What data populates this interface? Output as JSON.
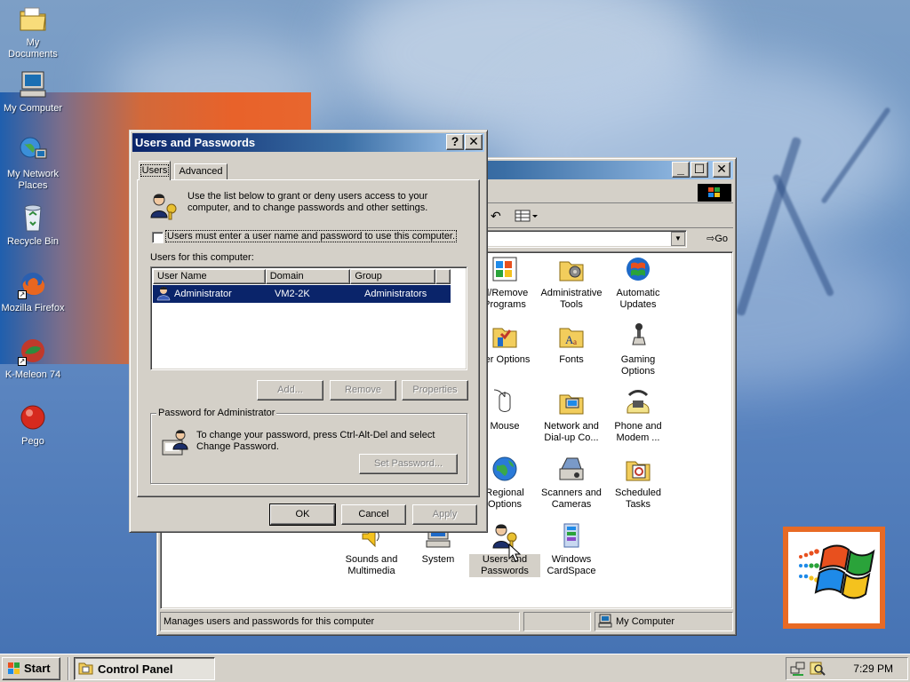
{
  "desktop": {
    "icons": [
      {
        "label": "My Documents",
        "icon": "folder-documents-icon"
      },
      {
        "label": "My Computer",
        "icon": "computer-icon"
      },
      {
        "label_line1": "My Network",
        "label_line2": "Places",
        "icon": "network-places-icon"
      },
      {
        "label": "Recycle Bin",
        "icon": "recycle-bin-icon"
      },
      {
        "label": "Mozilla Firefox",
        "icon": "firefox-icon"
      },
      {
        "label": "K-Meleon 74",
        "icon": "k-meleon-icon"
      },
      {
        "label": "Pego",
        "icon": "pego-icon"
      }
    ]
  },
  "control_panel": {
    "toolbar": {
      "go_label": "Go"
    },
    "icons": [
      {
        "line1": "ld/Remove",
        "line2": "Programs"
      },
      {
        "line1": "Administrative",
        "line2": "Tools"
      },
      {
        "line1": "Automatic",
        "line2": "Updates"
      },
      {
        "line1": "der Options",
        "line2": ""
      },
      {
        "line1": "Fonts",
        "line2": ""
      },
      {
        "line1": "Gaming",
        "line2": "Options"
      },
      {
        "line1": "Mouse",
        "line2": ""
      },
      {
        "line1": "Network and",
        "line2": "Dial-up Co..."
      },
      {
        "line1": "Phone and",
        "line2": "Modem ..."
      },
      {
        "line1": "Regional",
        "line2": "Options"
      },
      {
        "line1": "Scanners and",
        "line2": "Cameras"
      },
      {
        "line1": "Scheduled",
        "line2": "Tasks"
      },
      {
        "line1": "Sounds and",
        "line2": "Multimedia"
      },
      {
        "line1": "System",
        "line2": ""
      },
      {
        "line1": "Users and",
        "line2": "Passwords"
      },
      {
        "line1": "Windows",
        "line2": "CardSpace"
      }
    ],
    "status_text": "Manages users and passwords for this computer",
    "status_zone": "My Computer"
  },
  "dialog": {
    "title": "Users and Passwords",
    "help_glyph": "?",
    "close_glyph": "✕",
    "tabs": [
      {
        "label": "Users"
      },
      {
        "label": "Advanced"
      }
    ],
    "intro_line1": "Use the list below to grant or deny users access to your",
    "intro_line2": "computer, and to change passwords and other settings.",
    "checkbox_label": "Users must enter a user name and password to use this computer.",
    "users_label": "Users for this computer:",
    "columns": [
      "User Name",
      "Domain",
      "Group"
    ],
    "rows": [
      {
        "user": "Administrator",
        "domain": "VM2-2K",
        "group": "Administrators"
      }
    ],
    "buttons": {
      "add": "Add...",
      "remove": "Remove",
      "properties": "Properties"
    },
    "password_group_label": "Password for Administrator",
    "password_text_line1": "To change your password, press Ctrl-Alt-Del and select",
    "password_text_line2": "Change Password.",
    "set_password": "Set Password...",
    "ok": "OK",
    "cancel": "Cancel",
    "apply": "Apply"
  },
  "taskbar": {
    "start_label": "Start",
    "task_label": "Control Panel",
    "clock": "7:29 PM"
  },
  "colors": {
    "selection": "#0a246a",
    "title_active": "#0a246a",
    "face": "#d4d0c8"
  }
}
